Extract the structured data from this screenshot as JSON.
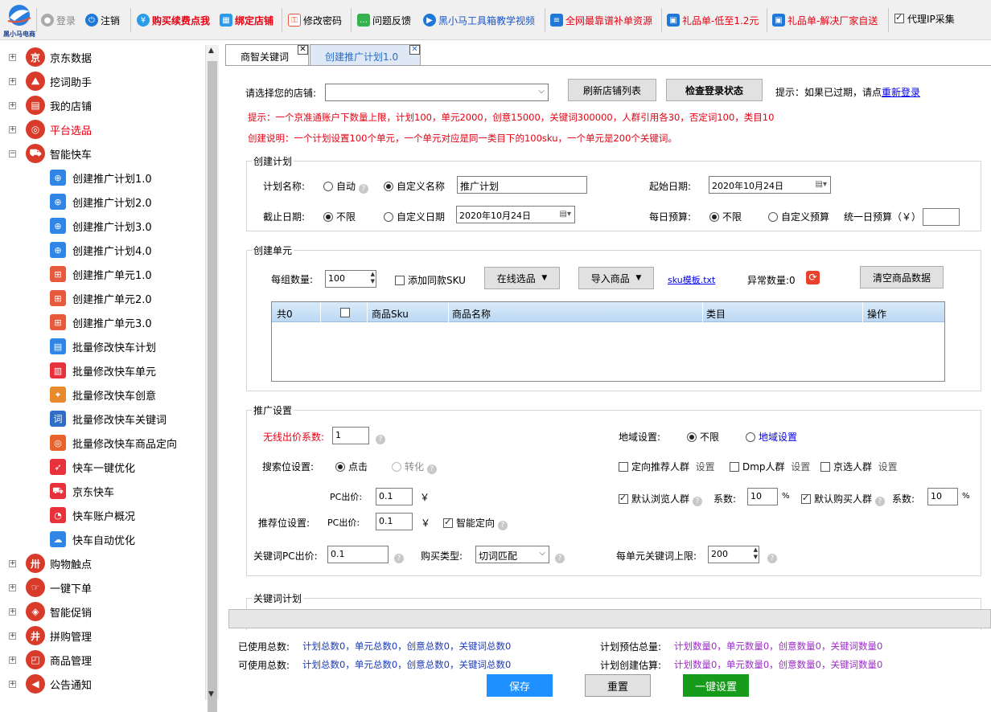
{
  "toolbar": {
    "logo_text": "黑小马电商",
    "login": "登录",
    "logout": "注销",
    "renew": "购买续费点我",
    "bind_shop": "绑定店铺",
    "change_pwd": "修改密码",
    "feedback": "问题反馈",
    "video": "黑小马工具箱教学视频",
    "resources": "全网最靠谱补单资源",
    "gift1": "礼品单-低至1.2元",
    "gift2": "礼品单-解决厂家自送",
    "proxy": "代理IP采集"
  },
  "sidebar": {
    "top_items": [
      "京东数据",
      "挖词助手",
      "我的店铺",
      "平台选品",
      "智能快车"
    ],
    "children": [
      "创建推广计划1.0",
      "创建推广计划2.0",
      "创建推广计划3.0",
      "创建推广计划4.0",
      "创建推广单元1.0",
      "创建推广单元2.0",
      "创建推广单元3.0",
      "批量修改快车计划",
      "批量修改快车单元",
      "批量修改快车创意",
      "批量修改快车关键词",
      "批量修改快车商品定向",
      "快车一键优化",
      "京东快车",
      "快车账户概况",
      "快车自动优化"
    ],
    "bottom_items": [
      "购物触点",
      "一键下单",
      "智能促销",
      "拼购管理",
      "商品管理",
      "公告通知"
    ]
  },
  "tabs": [
    "商智关键词",
    "创建推广计划1.0"
  ],
  "shop": {
    "label": "请选择您的店铺:",
    "refresh": "刷新店铺列表",
    "check": "检查登录状态",
    "hint": "提示：如果已过期，请点",
    "relogin": "重新登录"
  },
  "tips": {
    "line1": "提示：一个京准通账户下数量上限，计划100，单元2000，创意15000，关键词300000，人群引用各30，否定词100，类目10",
    "line2": "创建说明：一个计划设置100个单元，一个单元对应是同一类目下的100sku，一个单元是200个关键词。"
  },
  "plan": {
    "title": "创建计划",
    "name_label": "计划名称:",
    "auto": "自动",
    "custom_name": "自定义名称",
    "name_value": "推广计划",
    "start_label": "起始日期:",
    "start_value": "2020年10月24日",
    "end_label": "截止日期:",
    "unlimited": "不限",
    "custom_date": "自定义日期",
    "end_value": "2020年10月24日",
    "budget_label": "每日预算:",
    "budget_unlimited": "不限",
    "custom_budget": "自定义预算",
    "unified_budget": "统一日预算（￥）"
  },
  "unit": {
    "title": "创建单元",
    "group_label": "每组数量:",
    "group_value": "100",
    "same_sku": "添加同款SKU",
    "online": "在线选品",
    "import": "导入商品",
    "template": "sku模板.txt",
    "abnormal": "异常数量:0",
    "clear": "清空商品数据",
    "columns": [
      "共0",
      "",
      "商品Sku",
      "商品名称",
      "类目",
      "操作"
    ]
  },
  "promo": {
    "title": "推广设置",
    "wireless": "无线出价系数:",
    "wireless_value": "1",
    "region_label": "地域设置:",
    "region_unlimited": "不限",
    "region_set": "地域设置",
    "search_label": "搜索位设置:",
    "click": "点击",
    "convert": "转化",
    "targeted": "定向推荐人群",
    "dmp": "Dmp人群",
    "jd_pick": "京选人群",
    "setting": "设置",
    "pc_bid": "PC出价:",
    "pc_value": "0.1",
    "yen": "￥",
    "browse": "默认浏览人群",
    "coef": "系数:",
    "browse_value": "10",
    "buy": "默认购买人群",
    "buy_value": "10",
    "pct": "%",
    "recommend_label": "推荐位设置:",
    "rec_pc_value": "0.1",
    "smart": "智能定向",
    "kw_pc_label": "关键词PC出价:",
    "kw_pc_value": "0.1",
    "buy_type": "购买类型:",
    "buy_type_value": "切词匹配",
    "kw_limit": "每单元关键词上限:",
    "kw_limit_value": "200"
  },
  "kwplan": {
    "title": "关键词计划"
  },
  "bottom": {
    "used_label": "已使用总数:",
    "used_value": "计划总数0，单元总数0，创意总数0，关键词总数0",
    "avail_label": "可使用总数:",
    "avail_value": "计划总数0，单元总数0，创意总数0，关键词总数0",
    "plan_est_label": "计划预估总量:",
    "plan_est_value": "计划数量0，单元数量0，创意数量0，关键词数量0",
    "create_est_label": "计划创建估算:",
    "create_est_value": "计划数量0，单元数量0，创意数量0，关键词数量0",
    "save": "保存",
    "reset": "重置",
    "oneclick": "一键设置"
  },
  "colors": {
    "accent_blue": "#1e90ff",
    "green": "#169b1a",
    "red": "#e60012",
    "header_blue": "#cfe3f7"
  }
}
